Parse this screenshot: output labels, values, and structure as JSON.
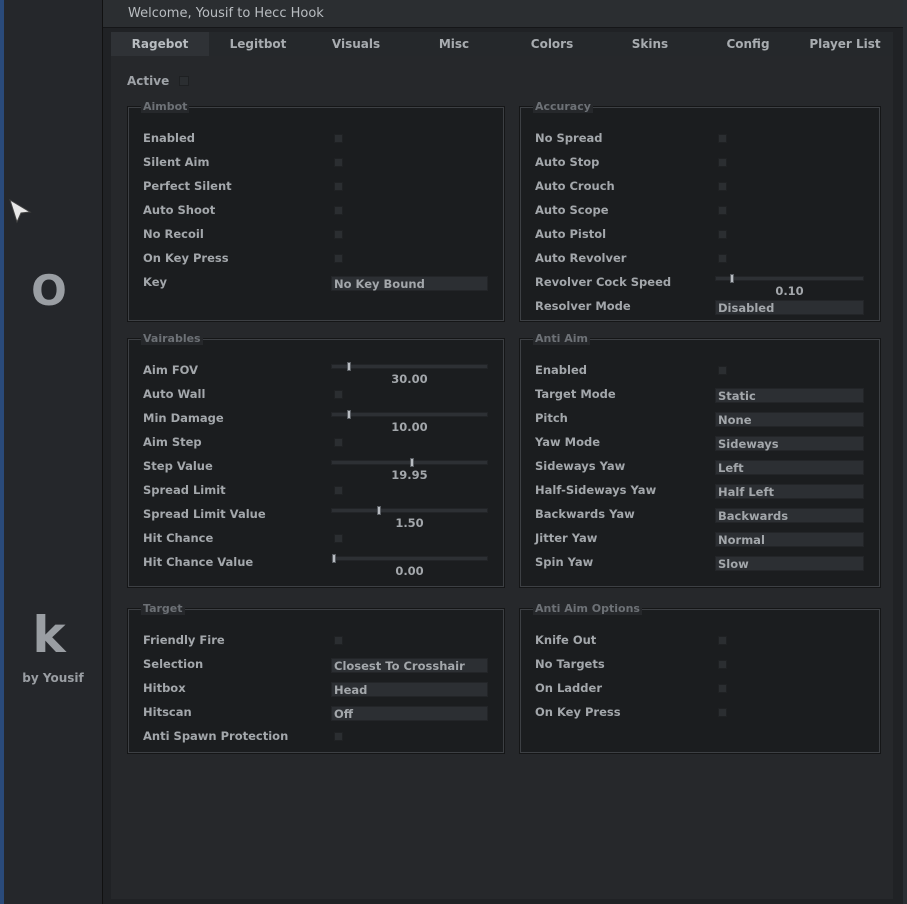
{
  "window": {
    "title": "Welcome, Yousif to Hecc Hook"
  },
  "sidebar": {
    "logo_top": "O",
    "logo_bottom": "k",
    "by_line": "by Yousif"
  },
  "tabs": [
    "Ragebot",
    "Legitbot",
    "Visuals",
    "Misc",
    "Colors",
    "Skins",
    "Config",
    "Player List"
  ],
  "active_tab": "Ragebot",
  "active_label": "Active",
  "aimbot": {
    "title": "Aimbot",
    "enabled": "Enabled",
    "silent_aim": "Silent Aim",
    "perfect_silent": "Perfect Silent",
    "auto_shoot": "Auto Shoot",
    "no_recoil": "No Recoil",
    "on_key_press": "On Key Press",
    "key": "Key",
    "key_value": "No Key Bound"
  },
  "accuracy": {
    "title": "Accuracy",
    "no_spread": "No Spread",
    "auto_stop": "Auto Stop",
    "auto_crouch": "Auto Crouch",
    "auto_scope": "Auto Scope",
    "auto_pistol": "Auto Pistol",
    "auto_revolver": "Auto Revolver",
    "revolver_cock_speed": "Revolver Cock Speed",
    "revolver_cock_speed_value": "0.10",
    "resolver_mode": "Resolver Mode",
    "resolver_mode_value": "Disabled"
  },
  "variables": {
    "title": "Vairables",
    "aim_fov": "Aim FOV",
    "aim_fov_value": "30.00",
    "auto_wall": "Auto Wall",
    "min_damage": "Min Damage",
    "min_damage_value": "10.00",
    "aim_step": "Aim Step",
    "step_value": "Step Value",
    "step_value_value": "19.95",
    "spread_limit": "Spread Limit",
    "spread_limit_value": "Spread Limit Value",
    "spread_limit_value_value": "1.50",
    "hit_chance": "Hit Chance",
    "hit_chance_value": "Hit Chance Value",
    "hit_chance_value_value": "0.00"
  },
  "anti_aim": {
    "title": "Anti Aim",
    "enabled": "Enabled",
    "target_mode": "Target Mode",
    "target_mode_value": "Static",
    "pitch": "Pitch",
    "pitch_value": "None",
    "yaw_mode": "Yaw Mode",
    "yaw_mode_value": "Sideways",
    "sideways_yaw": "Sideways Yaw",
    "sideways_yaw_value": "Left",
    "half_sideways_yaw": "Half-Sideways Yaw",
    "half_sideways_yaw_value": "Half Left",
    "backwards_yaw": "Backwards Yaw",
    "backwards_yaw_value": "Backwards",
    "jitter_yaw": "Jitter Yaw",
    "jitter_yaw_value": "Normal",
    "spin_yaw": "Spin Yaw",
    "spin_yaw_value": "Slow"
  },
  "target": {
    "title": "Target",
    "friendly_fire": "Friendly Fire",
    "selection": "Selection",
    "selection_value": "Closest To Crosshair",
    "hitbox": "Hitbox",
    "hitbox_value": "Head",
    "hitscan": "Hitscan",
    "hitscan_value": "Off",
    "anti_spawn_protection": "Anti Spawn Protection"
  },
  "anti_aim_options": {
    "title": "Anti Aim Options",
    "knife_out": "Knife Out",
    "no_targets": "No Targets",
    "on_ladder": "On Ladder",
    "on_key_press": "On Key Press"
  },
  "slider_levels": {
    "revolver_cock_speed": 0.1,
    "aim_fov": 0.1,
    "min_damage": 0.1,
    "step_value": 0.515,
    "spread_limit_value": 0.3,
    "hit_chance_value": 0.0
  }
}
